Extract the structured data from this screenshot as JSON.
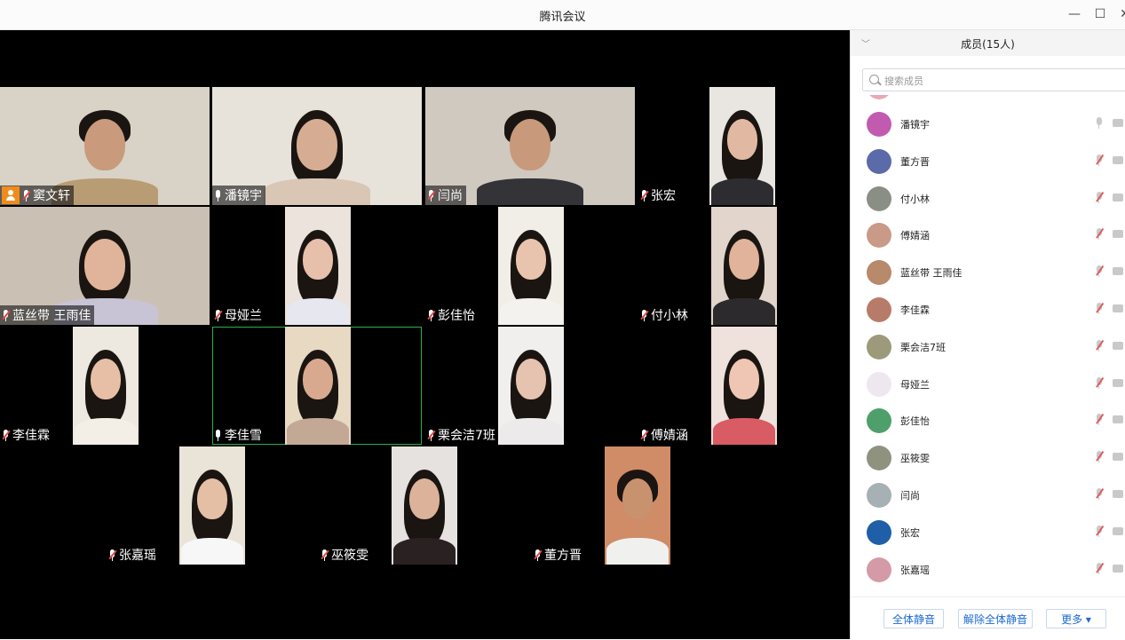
{
  "window": {
    "title": "腾讯会议",
    "minimize": "—",
    "maximize": "☐",
    "close": "✕"
  },
  "tiles": [
    {
      "name": "窦文轩",
      "host": true,
      "mic": "muted"
    },
    {
      "name": "潘镜宇",
      "mic": "live"
    },
    {
      "name": "闫尚",
      "mic": "muted"
    },
    {
      "name": "张宏",
      "mic": "muted"
    },
    {
      "name": "蓝丝带 王雨佳",
      "mic": "muted"
    },
    {
      "name": "母娅兰",
      "mic": "muted"
    },
    {
      "name": "彭佳怡",
      "mic": "muted"
    },
    {
      "name": "付小林",
      "mic": "muted"
    },
    {
      "name": "李佳霖",
      "mic": "muted"
    },
    {
      "name": "李佳雪",
      "mic": "live",
      "speaking": true
    },
    {
      "name": "栗会洁7班",
      "mic": "muted"
    },
    {
      "name": "傅婧涵",
      "mic": "muted"
    },
    {
      "name": "张嘉瑶",
      "mic": "muted"
    },
    {
      "name": "巫筱雯",
      "mic": "muted"
    },
    {
      "name": "董方晋",
      "mic": "muted"
    }
  ],
  "panel": {
    "title": "成员(15人)",
    "search_placeholder": "搜索成员",
    "members": [
      {
        "name": "潘镜宇",
        "muted": false
      },
      {
        "name": "董方晋",
        "muted": true
      },
      {
        "name": "付小林",
        "muted": true
      },
      {
        "name": "傅婧涵",
        "muted": true
      },
      {
        "name": "蓝丝带 王雨佳",
        "muted": true
      },
      {
        "name": "李佳霖",
        "muted": true
      },
      {
        "name": "栗会洁7班",
        "muted": true
      },
      {
        "name": "母娅兰",
        "muted": true
      },
      {
        "name": "彭佳怡",
        "muted": true
      },
      {
        "name": "巫筱雯",
        "muted": true
      },
      {
        "name": "闫尚",
        "muted": true
      },
      {
        "name": "张宏",
        "muted": true
      },
      {
        "name": "张嘉瑶",
        "muted": true
      }
    ],
    "buttons": {
      "mute_all": "全体静音",
      "unmute_all": "解除全体静音",
      "more": "更多 ▾"
    }
  },
  "colors": {
    "host_badge": "#f08c1a",
    "speaking_border": "#2ab04a",
    "link_blue": "#1c69d4"
  }
}
